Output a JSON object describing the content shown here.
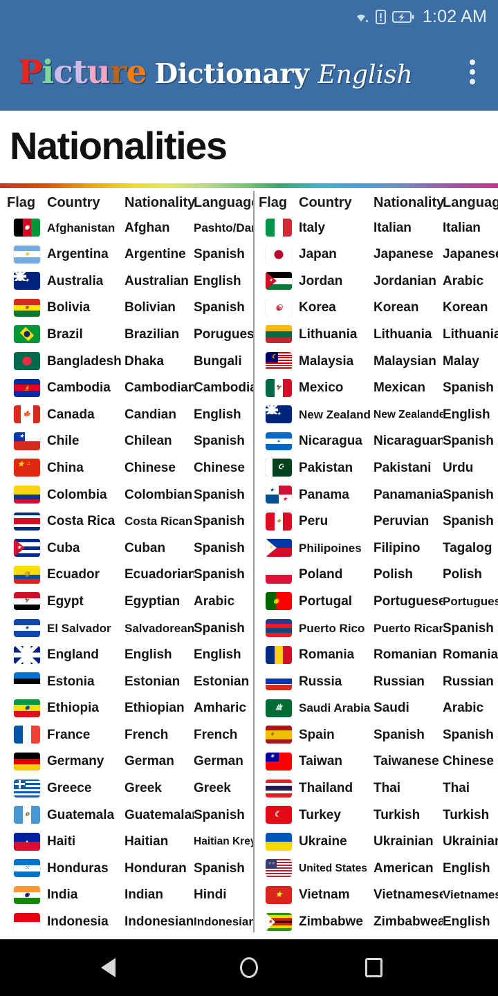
{
  "status_bar": {
    "time": "1:02 AM",
    "icons": [
      "wifi-icon",
      "sim-alert-icon",
      "battery-charging-icon"
    ]
  },
  "app_bar": {
    "logo_word1": "Picture",
    "logo_word1_letters": [
      {
        "ch": "P",
        "color": "#e8251f"
      },
      {
        "ch": "i",
        "color": "#7fd99a"
      },
      {
        "ch": "c",
        "color": "#c9bce8"
      },
      {
        "ch": "t",
        "color": "#cdbde6"
      },
      {
        "ch": "u",
        "color": "#f2a8c4"
      },
      {
        "ch": "r",
        "color": "#b5651d"
      },
      {
        "ch": "e",
        "color": "#ef7d1a"
      }
    ],
    "logo_word2": "Dictionary",
    "logo_word3": "English",
    "overflow_label": "More options",
    "background_color": "#3a6ea5"
  },
  "page": {
    "title": "Nationalities"
  },
  "table": {
    "headers": [
      "Flag",
      "Country",
      "Nationality",
      "Language"
    ],
    "left_rows": [
      {
        "country": "Afghanistan",
        "nationality": "Afghan",
        "language": "Pashto/Dari"
      },
      {
        "country": "Argentina",
        "nationality": "Argentine",
        "language": "Spanish"
      },
      {
        "country": "Australia",
        "nationality": "Australian",
        "language": "English"
      },
      {
        "country": "Bolivia",
        "nationality": "Bolivian",
        "language": "Spanish"
      },
      {
        "country": "Brazil",
        "nationality": "Brazilian",
        "language": "Poruguese"
      },
      {
        "country": "Bangladesh",
        "nationality": "Dhaka",
        "language": "Bungali"
      },
      {
        "country": "Cambodia",
        "nationality": "Cambodian",
        "language": "Cambodian"
      },
      {
        "country": "Canada",
        "nationality": "Candian",
        "language": "English"
      },
      {
        "country": "Chile",
        "nationality": "Chilean",
        "language": "Spanish"
      },
      {
        "country": "China",
        "nationality": "Chinese",
        "language": "Chinese"
      },
      {
        "country": "Colombia",
        "nationality": "Colombian",
        "language": "Spanish"
      },
      {
        "country": "Costa Rica",
        "nationality": "Costa Rican",
        "language": "Spanish"
      },
      {
        "country": "Cuba",
        "nationality": "Cuban",
        "language": "Spanish"
      },
      {
        "country": "Ecuador",
        "nationality": "Ecuadorian",
        "language": "Spanish"
      },
      {
        "country": "Egypt",
        "nationality": "Egyptian",
        "language": "Arabic"
      },
      {
        "country": "El Salvador",
        "nationality": "Salvadorean",
        "language": "Spanish"
      },
      {
        "country": "England",
        "nationality": "English",
        "language": "English"
      },
      {
        "country": "Estonia",
        "nationality": "Estonian",
        "language": "Estonian"
      },
      {
        "country": "Ethiopia",
        "nationality": "Ethiopian",
        "language": "Amharic"
      },
      {
        "country": "France",
        "nationality": "French",
        "language": "French"
      },
      {
        "country": "Germany",
        "nationality": "German",
        "language": "German"
      },
      {
        "country": "Greece",
        "nationality": "Greek",
        "language": "Greek"
      },
      {
        "country": "Guatemala",
        "nationality": "Guatemalan",
        "language": "Spanish"
      },
      {
        "country": "Haiti",
        "nationality": "Haitian",
        "language": "Haitian Kreyol"
      },
      {
        "country": "Honduras",
        "nationality": "Honduran",
        "language": "Spanish"
      },
      {
        "country": "India",
        "nationality": "Indian",
        "language": "Hindi"
      },
      {
        "country": "Indonesia",
        "nationality": "Indonesian",
        "language": "Indonesian"
      }
    ],
    "right_rows": [
      {
        "country": "Italy",
        "nationality": "Italian",
        "language": "Italian"
      },
      {
        "country": "Japan",
        "nationality": "Japanese",
        "language": "Japanese"
      },
      {
        "country": "Jordan",
        "nationality": "Jordanian",
        "language": "Arabic"
      },
      {
        "country": "Korea",
        "nationality": "Korean",
        "language": "Korean"
      },
      {
        "country": "Lithuania",
        "nationality": "Lithuania",
        "language": "Lithuania"
      },
      {
        "country": "Malaysia",
        "nationality": "Malaysian",
        "language": "Malay"
      },
      {
        "country": "Mexico",
        "nationality": "Mexican",
        "language": "Spanish"
      },
      {
        "country": "New Zealand",
        "nationality": "New Zealander",
        "language": "English"
      },
      {
        "country": "Nicaragua",
        "nationality": "Nicaraguan",
        "language": "Spanish"
      },
      {
        "country": "Pakistan",
        "nationality": "Pakistani",
        "language": "Urdu"
      },
      {
        "country": "Panama",
        "nationality": "Panamanian",
        "language": "Spanish"
      },
      {
        "country": "Peru",
        "nationality": "Peruvian",
        "language": "Spanish"
      },
      {
        "country": "Philipoines",
        "nationality": "Filipino",
        "language": "Tagalog"
      },
      {
        "country": "Poland",
        "nationality": "Polish",
        "language": "Polish"
      },
      {
        "country": "Portugal",
        "nationality": "Portuguese",
        "language": "Portuguese"
      },
      {
        "country": "Puerto Rico",
        "nationality": "Puerto Rican",
        "language": "Spanish"
      },
      {
        "country": "Romania",
        "nationality": "Romanian",
        "language": "Romanian"
      },
      {
        "country": "Russia",
        "nationality": "Russian",
        "language": "Russian"
      },
      {
        "country": "Saudi Arabia",
        "nationality": "Saudi",
        "language": "Arabic"
      },
      {
        "country": "Spain",
        "nationality": "Spanish",
        "language": "Spanish"
      },
      {
        "country": "Taiwan",
        "nationality": "Taiwanese",
        "language": "Chinese"
      },
      {
        "country": "Thailand",
        "nationality": "Thai",
        "language": "Thai"
      },
      {
        "country": "Turkey",
        "nationality": "Turkish",
        "language": "Turkish"
      },
      {
        "country": "Ukraine",
        "nationality": "Ukrainian",
        "language": "Ukrainian"
      },
      {
        "country": "United States",
        "nationality": "American",
        "language": "English"
      },
      {
        "country": "Vietnam",
        "nationality": "Vietnamese",
        "language": "Vietnamese"
      },
      {
        "country": "Zimbabwe",
        "nationality": "Zimbabwean",
        "language": "English"
      }
    ]
  },
  "nav_bar": {
    "back_label": "Back",
    "home_label": "Home",
    "recents_label": "Recents"
  }
}
